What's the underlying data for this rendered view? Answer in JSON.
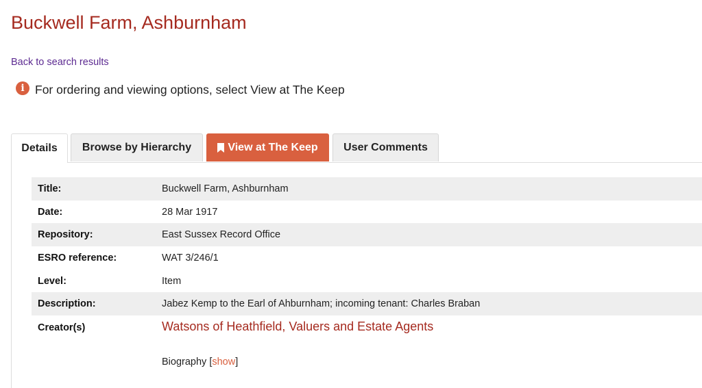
{
  "header": {
    "title": "Buckwell Farm, Ashburnham",
    "back_link": "Back to search results"
  },
  "info": {
    "icon": "info-circle-icon",
    "text": "For ordering and viewing options, select View at The Keep"
  },
  "tabs": [
    {
      "label": "Details",
      "active": true
    },
    {
      "label": "Browse by Hierarchy",
      "active": false
    },
    {
      "label": "View at The Keep",
      "active": false,
      "icon": "bookmark-icon"
    },
    {
      "label": "User Comments",
      "active": false
    }
  ],
  "details": {
    "rows": [
      {
        "label": "Title:",
        "value": "Buckwell Farm, Ashburnham"
      },
      {
        "label": "Date:",
        "value": "28 Mar 1917"
      },
      {
        "label": "Repository:",
        "value": "East Sussex Record Office"
      },
      {
        "label": "ESRO reference:",
        "value": "WAT 3/246/1"
      },
      {
        "label": "Level:",
        "value": "Item"
      },
      {
        "label": "Description:",
        "value": "Jabez Kemp to the Earl of Ahburnham; incoming tenant: Charles Braban"
      }
    ],
    "creator": {
      "label": "Creator(s)",
      "name": "Watsons of Heathfield, Valuers and Estate Agents",
      "biography_label": "Biography",
      "show_label": "show"
    }
  },
  "colors": {
    "title": "#a52a1f",
    "link_visited": "#5c2a91",
    "accent": "#d9603f",
    "tab_bg": "#eeeeee",
    "row_shade": "#eeeeee"
  }
}
